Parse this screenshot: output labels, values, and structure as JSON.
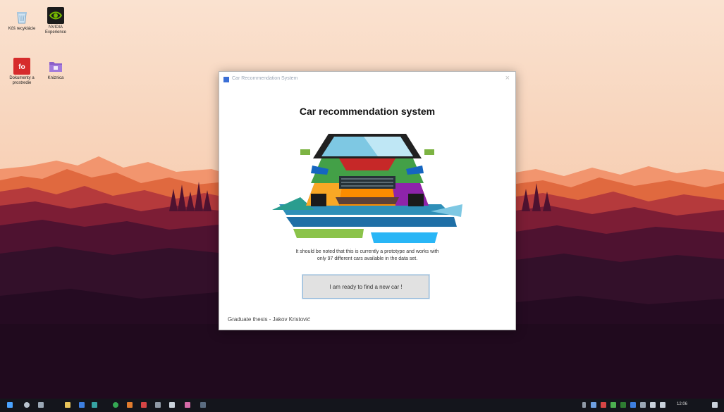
{
  "desktop": {
    "icons": [
      {
        "label": "Kôš recyklácie",
        "icon": "recycle-bin-icon"
      },
      {
        "label": "NVIDIA Experience",
        "icon": "nvidia-icon"
      },
      {
        "label": "Dokumenty a prostredie",
        "icon": "foxit-reader-icon"
      },
      {
        "label": "Kniznica",
        "icon": "folder-icon"
      }
    ]
  },
  "window": {
    "title": "Car Recommendation System",
    "close_label": "×"
  },
  "main": {
    "heading": "Car recommendation system",
    "note_line1": "It should be noted that this is currently a prototype and works with",
    "note_line2": "only 97 different cars available in the data set.",
    "button_label": "I am ready to find a new car !",
    "footer": "Graduate thesis - Jakov Kristović"
  },
  "taskbar": {
    "time": "12:06"
  },
  "colors": {
    "window_bg": "#ffffff",
    "button_bg": "#e1e1e1",
    "button_border": "#8fb6d8",
    "taskbar_bg": "#14151c",
    "sky_top": "#f8dcc6",
    "sky_bottom": "#f1b490",
    "forest_dark": "#2a0d20"
  }
}
